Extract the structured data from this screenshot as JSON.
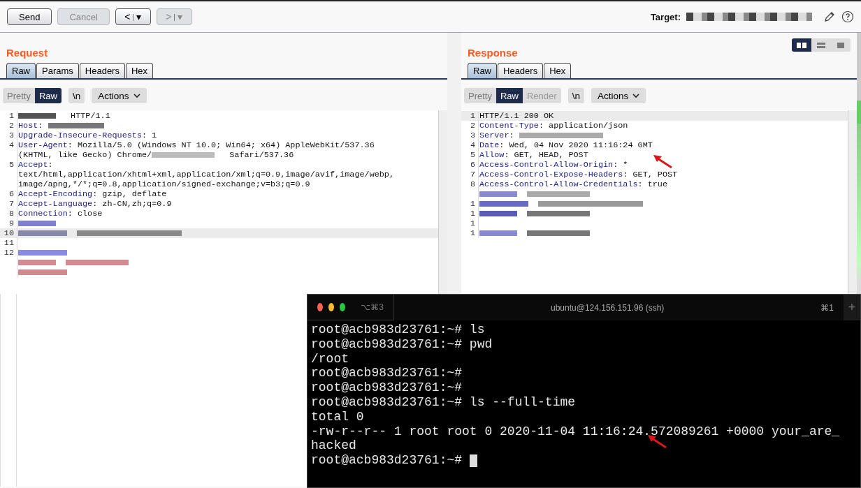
{
  "toolbar": {
    "buttons": [
      {
        "label": "Send",
        "disabled": false
      },
      {
        "label": "Cancel",
        "disabled": true
      }
    ],
    "history": [
      {
        "arrow": "<",
        "caret": "▾",
        "disabled": false
      },
      {
        "arrow": ">",
        "caret": "▾",
        "disabled": true
      }
    ],
    "target_label": "Target:"
  },
  "request": {
    "title": "Request",
    "tabs": [
      {
        "label": "Raw",
        "selected": true
      },
      {
        "label": "Params",
        "selected": false
      },
      {
        "label": "Headers",
        "selected": false
      },
      {
        "label": "Hex",
        "selected": false
      }
    ],
    "view_modes": [
      {
        "label": "Pretty",
        "selected": false
      },
      {
        "label": "Raw",
        "selected": true
      }
    ],
    "newline_toggle": "\\n",
    "actions": "Actions",
    "lines": [
      {
        "number": "1",
        "highlighted": false,
        "rows": [
          [
            {
              "kind": "redacted",
              "color": "#555555"
            },
            {
              "kind": "text",
              "text": " HTTP/1.1"
            }
          ]
        ]
      },
      {
        "number": "2",
        "highlighted": false,
        "rows": [
          [
            {
              "kind": "key",
              "text": "Host"
            },
            {
              "kind": "text",
              "text": ": "
            },
            {
              "kind": "redacted",
              "color": "#777777"
            }
          ]
        ]
      },
      {
        "number": "3",
        "highlighted": false,
        "rows": [
          [
            {
              "kind": "key",
              "text": "Upgrade-Insecure-Requests"
            },
            {
              "kind": "text",
              "text": ": 1"
            }
          ]
        ]
      },
      {
        "number": "4",
        "highlighted": false,
        "rows": [
          [
            {
              "kind": "key",
              "text": "User-Agent"
            },
            {
              "kind": "text",
              "text": ": Mozilla/5.0 (Windows NT 10.0; Win64; x64) AppleWebKit/537.36"
            }
          ],
          [
            {
              "kind": "text",
              "text": "(KHTML, like Gecko) Chrome/"
            },
            {
              "kind": "redacted",
              "color": "#bbbbbb"
            },
            {
              "kind": "text",
              "text": " Safari/537.36"
            }
          ]
        ]
      },
      {
        "number": "5",
        "highlighted": false,
        "rows": [
          [
            {
              "kind": "key",
              "text": "Accept"
            },
            {
              "kind": "text",
              "text": ":"
            }
          ],
          [
            {
              "kind": "text",
              "text": "text/html,application/xhtml+xml,application/xml;q=0.9,image/avif,image/webp,"
            }
          ],
          [
            {
              "kind": "text",
              "text": "image/apng,*/*;q=0.8,application/signed-exchange;v=b3;q=0.9"
            }
          ]
        ]
      },
      {
        "number": "6",
        "highlighted": false,
        "rows": [
          [
            {
              "kind": "key",
              "text": "Accept-Encoding"
            },
            {
              "kind": "text",
              "text": ": gzip, deflate"
            }
          ]
        ]
      },
      {
        "number": "7",
        "highlighted": false,
        "rows": [
          [
            {
              "kind": "key",
              "text": "Accept-Language"
            },
            {
              "kind": "text",
              "text": ": zh-CN,zh;q=0.9"
            }
          ]
        ]
      },
      {
        "number": "8",
        "highlighted": false,
        "rows": [
          [
            {
              "kind": "key",
              "text": "Connection"
            },
            {
              "kind": "text",
              "text": ": close"
            }
          ]
        ]
      },
      {
        "number": "9",
        "highlighted": false,
        "rows": [
          [
            {
              "kind": "redacted",
              "color": "#8080cc"
            }
          ]
        ]
      },
      {
        "number": "10",
        "highlighted": true,
        "rows": [
          [
            {
              "kind": "redacted",
              "color": "#8888aa"
            },
            {
              "kind": "redacted",
              "color": "#888888"
            }
          ]
        ]
      },
      {
        "number": "11",
        "highlighted": false,
        "rows": [
          []
        ]
      },
      {
        "number": "12",
        "highlighted": false,
        "rows": [
          [
            {
              "kind": "redacted",
              "color": "#8a8ae0"
            }
          ],
          [
            {
              "kind": "redacted",
              "color": "#d08a90"
            },
            {
              "kind": "redacted",
              "color": "#d08a90"
            }
          ],
          [
            {
              "kind": "redacted",
              "color": "#d08a90"
            }
          ]
        ]
      }
    ]
  },
  "response": {
    "title": "Response",
    "layout_options": [
      {
        "kind": "split",
        "selected": true
      },
      {
        "kind": "stacked",
        "selected": false
      },
      {
        "kind": "single",
        "selected": false
      }
    ],
    "tabs": [
      {
        "label": "Raw",
        "selected": true
      },
      {
        "label": "Headers",
        "selected": false
      },
      {
        "label": "Hex",
        "selected": false
      }
    ],
    "view_modes": [
      {
        "label": "Pretty",
        "selected": false,
        "disabled": false
      },
      {
        "label": "Raw",
        "selected": true,
        "disabled": false
      },
      {
        "label": "Render",
        "selected": false,
        "disabled": true
      }
    ],
    "newline_toggle": "\\n",
    "actions": "Actions",
    "lines": [
      {
        "number": "1",
        "highlighted": true,
        "rows": [
          [
            {
              "kind": "text",
              "text": "HTTP/1.1 200 OK"
            }
          ]
        ]
      },
      {
        "number": "2",
        "highlighted": false,
        "rows": [
          [
            {
              "kind": "key",
              "text": "Content-Type"
            },
            {
              "kind": "text",
              "text": ": application/json"
            }
          ]
        ]
      },
      {
        "number": "3",
        "highlighted": false,
        "rows": [
          [
            {
              "kind": "key",
              "text": "Server"
            },
            {
              "kind": "text",
              "text": ": "
            },
            {
              "kind": "redacted",
              "color": "#aaaaaa"
            }
          ]
        ]
      },
      {
        "number": "4",
        "highlighted": false,
        "rows": [
          [
            {
              "kind": "key",
              "text": "Date"
            },
            {
              "kind": "text",
              "text": ": Wed, 04 Nov 2020 11:16:24 GMT"
            }
          ]
        ]
      },
      {
        "number": "5",
        "highlighted": false,
        "rows": [
          [
            {
              "kind": "key",
              "text": "Allow"
            },
            {
              "kind": "text",
              "text": ": GET, HEAD, POST"
            }
          ]
        ]
      },
      {
        "number": "6",
        "highlighted": false,
        "rows": [
          [
            {
              "kind": "key",
              "text": "Access-Control-Allow-Origin"
            },
            {
              "kind": "text",
              "text": ": *"
            }
          ]
        ]
      },
      {
        "number": "7",
        "highlighted": false,
        "rows": [
          [
            {
              "kind": "key",
              "text": "Access-Control-Expose-Headers"
            },
            {
              "kind": "text",
              "text": ": GET, POST"
            }
          ]
        ]
      },
      {
        "number": "8",
        "highlighted": false,
        "rows": [
          [
            {
              "kind": "key",
              "text": "Access-Control-Allow-Credentials"
            },
            {
              "kind": "text",
              "text": ": true"
            }
          ]
        ]
      },
      {
        "highlighted": false,
        "rows": [
          [
            {
              "kind": "redacted",
              "color": "#8a8ad0"
            },
            {
              "kind": "redacted",
              "color": "#aaaaaa"
            }
          ]
        ]
      },
      {
        "number": "1",
        "highlighted": false,
        "rows": [
          [
            {
              "kind": "redacted",
              "color": "#6a6ac0"
            },
            {
              "kind": "redacted",
              "color": "#999999"
            }
          ]
        ]
      },
      {
        "number": "1",
        "highlighted": false,
        "rows": [
          [
            {
              "kind": "redacted",
              "color": "#5a5ab8"
            },
            {
              "kind": "redacted",
              "color": "#777777"
            }
          ]
        ]
      },
      {
        "number": "1",
        "highlighted": false,
        "rows": [
          []
        ]
      },
      {
        "number": "1",
        "highlighted": false,
        "rows": [
          [
            {
              "kind": "redacted",
              "color": "#8a8ad0"
            },
            {
              "kind": "redacted",
              "color": "#777777"
            }
          ]
        ]
      }
    ]
  },
  "terminal": {
    "tab_shortcut": "⌥⌘3",
    "title": "ubuntu@124.156.151.96 (ssh)",
    "window_shortcut": "⌘1",
    "new_tab": "+",
    "lines": [
      "root@acb983d23761:~# ls",
      "root@acb983d23761:~# pwd",
      "/root",
      "root@acb983d23761:~#",
      "root@acb983d23761:~#",
      "root@acb983d23761:~# ls --full-time",
      "total 0",
      "-rw-r--r-- 1 root root 0 2020-11-04 11:16:24.572089261 +0000 your_are_",
      "hacked",
      "root@acb983d23761:~#"
    ],
    "cursor": true
  }
}
